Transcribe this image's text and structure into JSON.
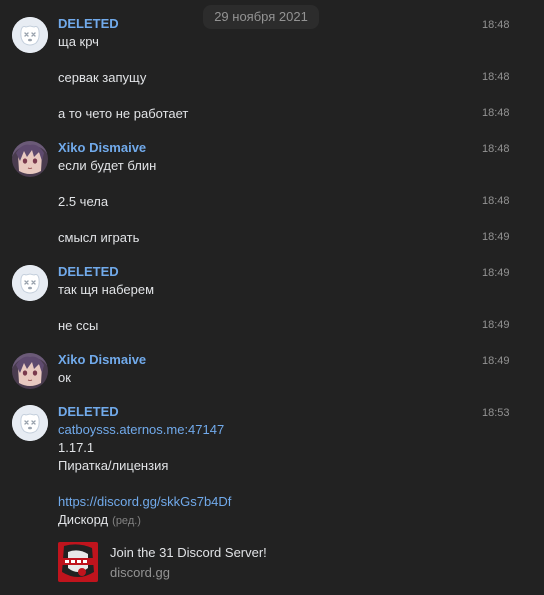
{
  "date_separator": "29 ноября 2021",
  "users": {
    "deleted": "DELETED",
    "xiko": "Xiko Dismaive"
  },
  "messages": [
    {
      "sender": "DELETED",
      "text": "ща крч",
      "time": "18:48"
    },
    {
      "text": "сервак запущу",
      "time": "18:48"
    },
    {
      "text": "а то чето не работает",
      "time": "18:48"
    },
    {
      "sender": "Xiko Dismaive",
      "text": "если будет блин",
      "time": "18:48"
    },
    {
      "text": "2.5 чела",
      "time": "18:48"
    },
    {
      "text": "смысл играть",
      "time": "18:49"
    },
    {
      "sender": "DELETED",
      "text": "так щя наберем",
      "time": "18:49"
    },
    {
      "text": "не ссы",
      "time": "18:49"
    },
    {
      "sender": "Xiko Dismaive",
      "text": "ок",
      "time": "18:49"
    },
    {
      "sender": "DELETED",
      "time": "18:53",
      "lines": [
        "catboysss.aternos.me:47147",
        "1.17.1",
        "Пиратка/лицензия",
        "",
        "https://discord.gg/skkGs7b4Df",
        "Дискорд"
      ],
      "edited_label": "(ред.)"
    }
  ],
  "embed": {
    "title": "Join the 31 Discord Server!",
    "domain": "discord.gg"
  },
  "colors": {
    "background": "#222222",
    "sender_name": "#71aaeb",
    "link": "#71aaeb",
    "text": "#e1e3e6",
    "timestamp": "#939393"
  }
}
